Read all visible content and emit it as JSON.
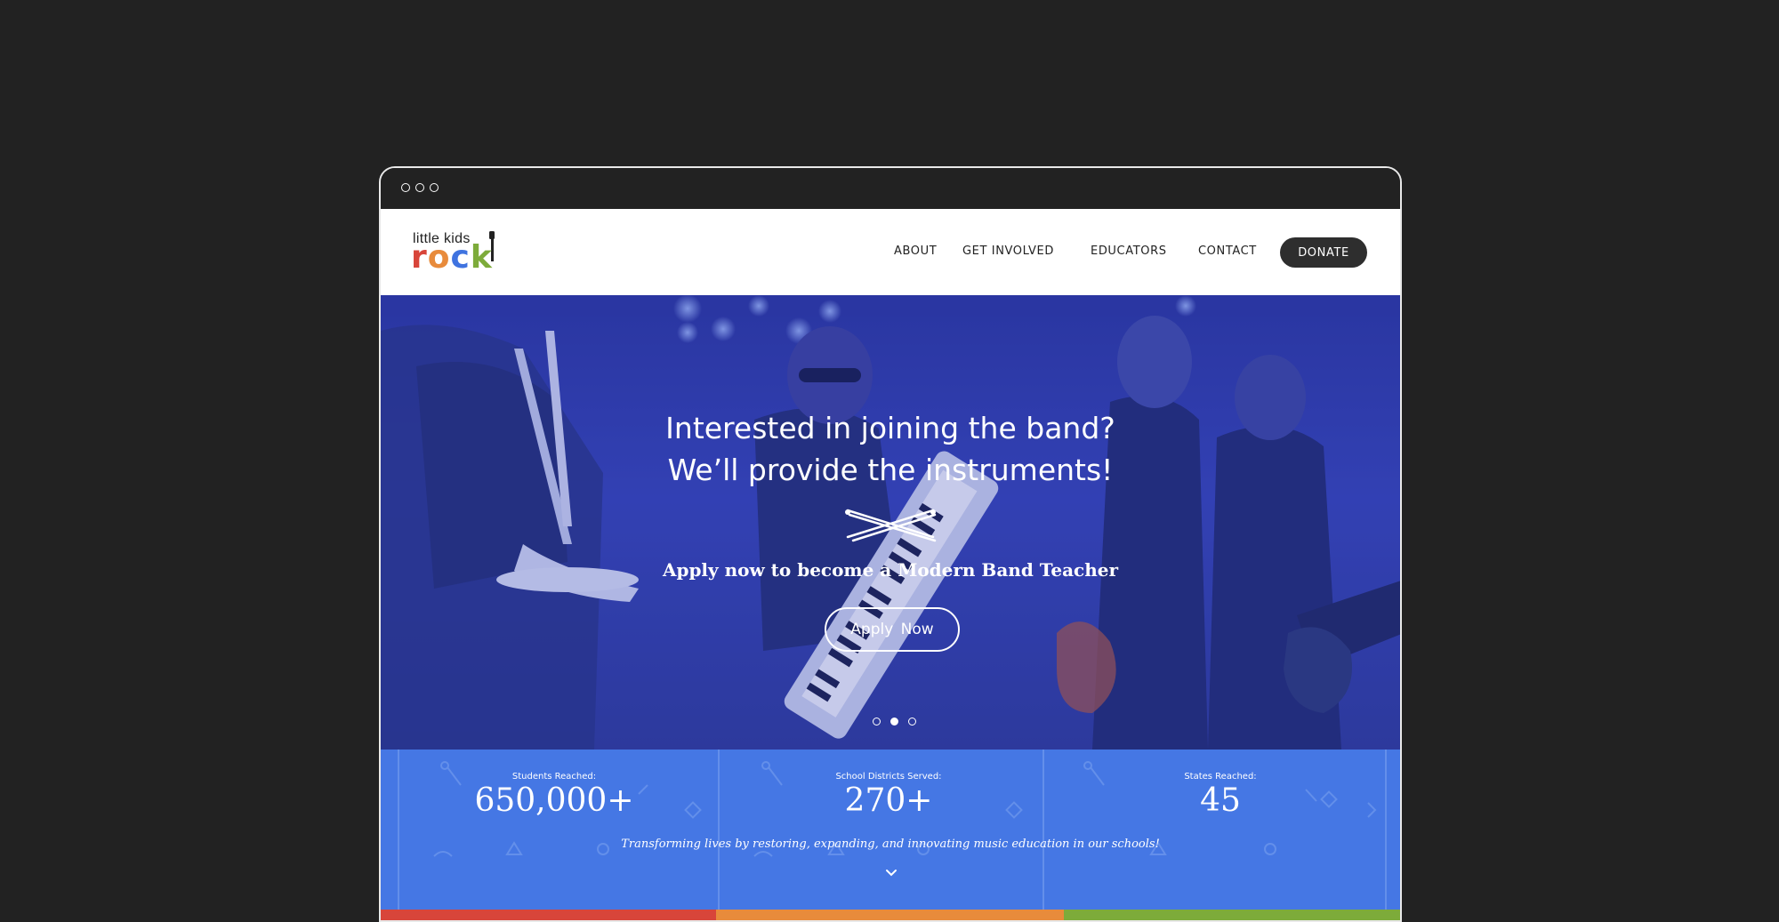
{
  "logo": {
    "top_text": "little kids",
    "letters": [
      "r",
      "o",
      "c",
      "k"
    ],
    "letter_colors": [
      "#d8453a",
      "#e88b3b",
      "#3f73e0",
      "#7dab3a"
    ]
  },
  "nav": {
    "items": [
      {
        "label": "ABOUT"
      },
      {
        "label": "GET INVOLVED"
      },
      {
        "label": "EDUCATORS"
      },
      {
        "label": "CONTACT"
      }
    ],
    "donate_label": "DONATE"
  },
  "hero": {
    "title_line1": "Interested in joining the band?",
    "title_line2": "We’ll provide the instruments!",
    "subtitle": "Apply now to become a Modern Band Teacher",
    "button_label": "Apply  Now",
    "slides": {
      "count": 3,
      "active": 2
    },
    "icons": {
      "divider": "crossed-drumsticks-icon"
    }
  },
  "stats": {
    "items": [
      {
        "label": "Students Reached:",
        "value": "650,000+"
      },
      {
        "label": "School Districts Served:",
        "value": "270+"
      },
      {
        "label": "States Reached:",
        "value": "45"
      }
    ],
    "tagline": "Transforming lives by restoring, expanding, and innovating music education in our schools!",
    "icons": {
      "scroll": "chevron-down-icon"
    }
  },
  "colors": {
    "page_background": "#222222",
    "nav_button": "#2e2e2e",
    "hero_overlay": "#3341b4",
    "stats_background": "#4577e4",
    "bar_colors": [
      "#d8453a",
      "#e88b3b",
      "#7dab3a"
    ]
  }
}
